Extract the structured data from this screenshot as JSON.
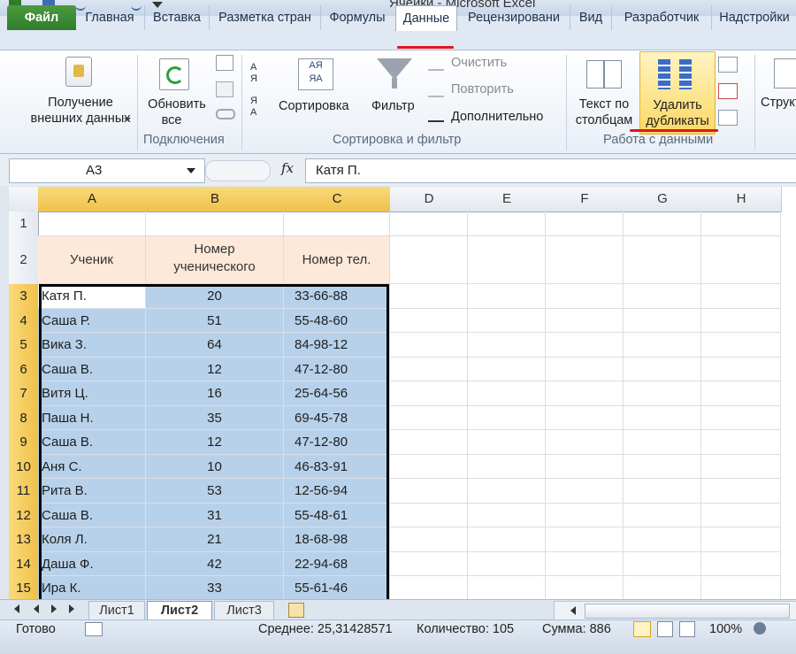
{
  "window": {
    "title": "Ячейки - Microsoft Excel"
  },
  "tabs": [
    "Файл",
    "Главная",
    "Вставка",
    "Разметка стран",
    "Формулы",
    "Данные",
    "Рецензировани",
    "Вид",
    "Разработчик",
    "Надстройки"
  ],
  "ribbon": {
    "get_external": [
      "Получение",
      "внешних данных"
    ],
    "refresh_all": [
      "Обновить",
      "все"
    ],
    "connections_group": "Подключения",
    "sort": "Сортировка",
    "filter": "Фильтр",
    "clear": "Очистить",
    "reapply": "Повторить",
    "advanced": "Дополнительно",
    "sort_filter_group": "Сортировка и фильтр",
    "text_to_columns": [
      "Текст по",
      "столбцам"
    ],
    "remove_duplicates": [
      "Удалить",
      "дубликаты"
    ],
    "data_tools_group": "Работа с данными",
    "outline": "Структ"
  },
  "formula_bar": {
    "cell_ref": "A3",
    "fx": "fx",
    "value": "Катя П."
  },
  "sheet": {
    "columns": [
      "A",
      "B",
      "C",
      "D",
      "E",
      "F",
      "G",
      "H"
    ],
    "rows": [
      "1",
      "2",
      "3",
      "4",
      "5",
      "6",
      "7",
      "8",
      "9",
      "10",
      "11",
      "12",
      "13",
      "14",
      "15"
    ],
    "headers": {
      "a": "Ученик",
      "b": [
        "Номер",
        "ученического"
      ],
      "c": "Номер тел."
    },
    "data": [
      [
        "Катя П.",
        "20",
        "33-66-88"
      ],
      [
        "Саша Р.",
        "51",
        "55-48-60"
      ],
      [
        "Вика З.",
        "64",
        "84-98-12"
      ],
      [
        "Саша В.",
        "12",
        "47-12-80"
      ],
      [
        "Витя Ц.",
        "16",
        "25-64-56"
      ],
      [
        "Паша Н.",
        "35",
        "69-45-78"
      ],
      [
        "Саша В.",
        "12",
        "47-12-80"
      ],
      [
        "Аня С.",
        "10",
        "46-83-91"
      ],
      [
        "Рита В.",
        "53",
        "12-56-94"
      ],
      [
        "Саша В.",
        "31",
        "55-48-61"
      ],
      [
        "Коля Л.",
        "21",
        "18-68-98"
      ],
      [
        "Даша Ф.",
        "42",
        "22-94-68"
      ],
      [
        "Ира К.",
        "33",
        "55-61-46"
      ]
    ]
  },
  "sheet_tabs": [
    "Лист1",
    "Лист2",
    "Лист3"
  ],
  "status": {
    "ready": "Готово",
    "average": "Среднее: 25,31428571",
    "count": "Количество: 105",
    "sum": "Сумма: 886",
    "zoom": "100%"
  },
  "colors": {
    "accent": "#2e7d2c",
    "selection": "#b8d1ea",
    "header_fill": "#fde9d9",
    "highlight": "#f0c14b",
    "annotation": "#e4141b"
  }
}
